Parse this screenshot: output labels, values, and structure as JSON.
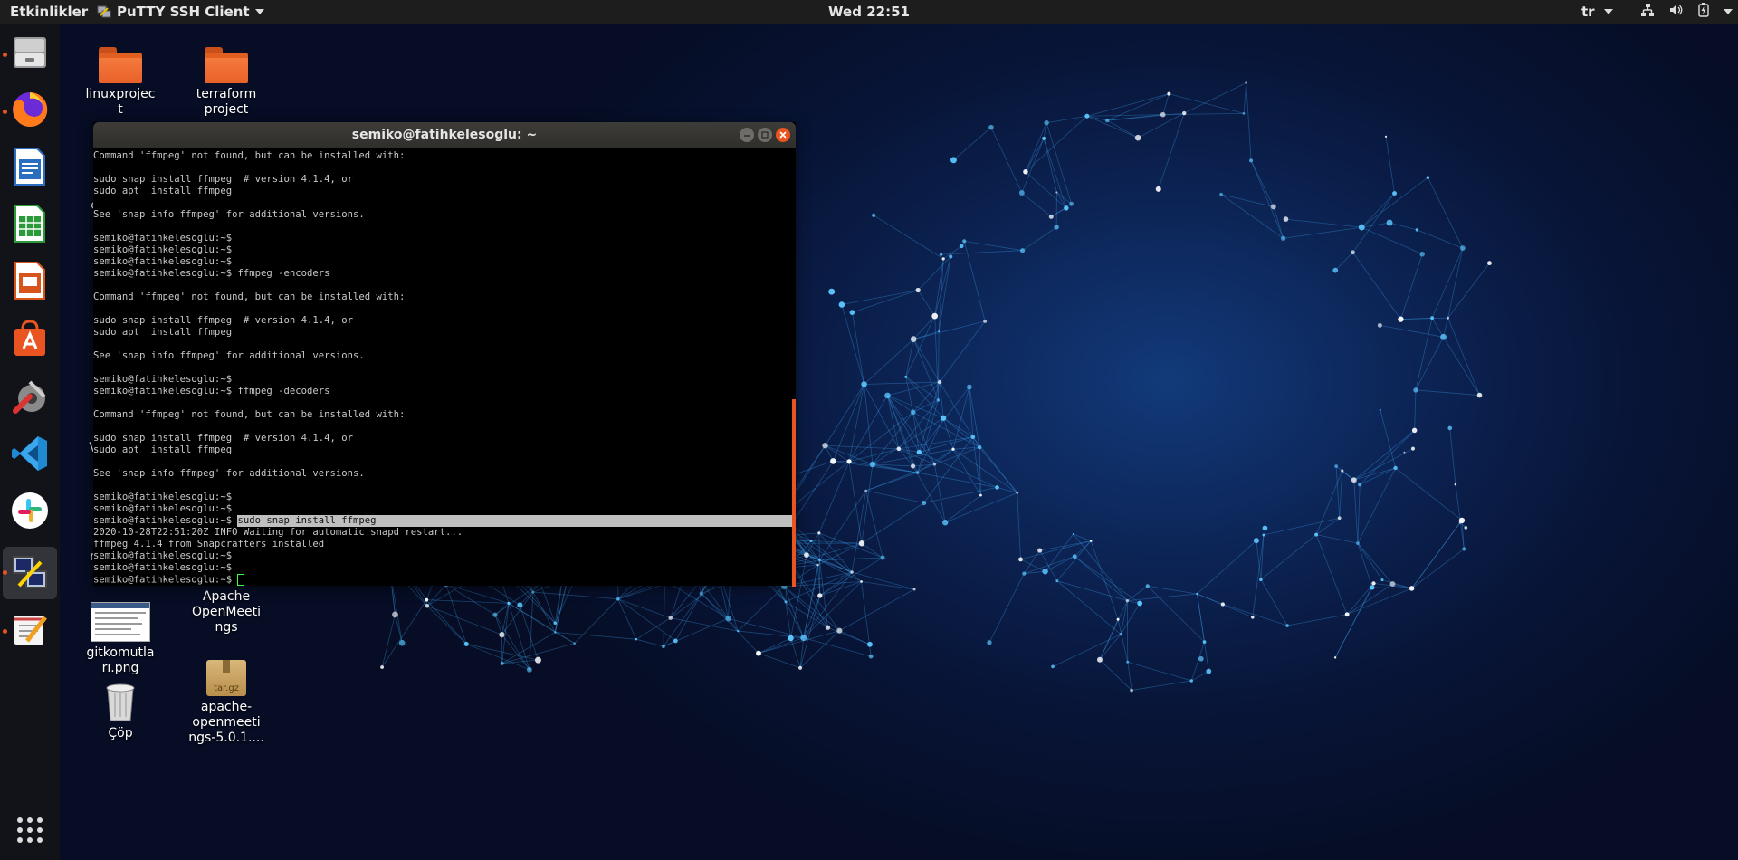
{
  "topbar": {
    "activities": "Etkinlikler",
    "app_name": "PuTTY SSH Client",
    "clock": "Wed 22:51",
    "language": "tr"
  },
  "desktop": {
    "icons": [
      {
        "label": "linuxprojec\nt",
        "type": "folder"
      },
      {
        "label": "terraform\nproject",
        "type": "folder"
      },
      {
        "label": "Apache\nOpenMeeti\nngs",
        "type": "folder"
      },
      {
        "label": "gitkomutla\nrı.png",
        "type": "image"
      },
      {
        "label": "Çöp",
        "type": "trash"
      },
      {
        "label": "apache-\nopenmeeti\nngs-5.0.1....",
        "type": "archive"
      }
    ],
    "archive_badge": "tar.gz",
    "partial_labels": [
      "c",
      "V",
      "n"
    ]
  },
  "dock": {
    "items": [
      "files-icon",
      "firefox-icon",
      "writer-icon",
      "calc-icon",
      "impress-icon",
      "software-icon",
      "settings-icon",
      "vscode-icon",
      "slack-icon",
      "putty-icon",
      "text-editor-icon"
    ],
    "apps_grid": "show-applications-icon"
  },
  "terminal": {
    "title": "semiko@fatihkelesoglu: ~",
    "lines": [
      "Command 'ffmpeg' not found, but can be installed with:",
      "",
      "sudo snap install ffmpeg  # version 4.1.4, or",
      "sudo apt  install ffmpeg",
      "",
      "See 'snap info ffmpeg' for additional versions.",
      "",
      "semiko@fatihkelesoglu:~$",
      "semiko@fatihkelesoglu:~$",
      "semiko@fatihkelesoglu:~$",
      "semiko@fatihkelesoglu:~$ ffmpeg -encoders",
      "",
      "Command 'ffmpeg' not found, but can be installed with:",
      "",
      "sudo snap install ffmpeg  # version 4.1.4, or",
      "sudo apt  install ffmpeg",
      "",
      "See 'snap info ffmpeg' for additional versions.",
      "",
      "semiko@fatihkelesoglu:~$",
      "semiko@fatihkelesoglu:~$ ffmpeg -decoders",
      "",
      "Command 'ffmpeg' not found, but can be installed with:",
      "",
      "sudo snap install ffmpeg  # version 4.1.4, or",
      "sudo apt  install ffmpeg",
      "",
      "See 'snap info ffmpeg' for additional versions.",
      "",
      "semiko@fatihkelesoglu:~$",
      "semiko@fatihkelesoglu:~$",
      "semiko@fatihkelesoglu:~$ "
    ],
    "highlighted_command": "sudo snap install ffmpeg",
    "after_lines": [
      "2020-10-28T22:51:20Z INFO Waiting for automatic snapd restart...",
      "ffmpeg 4.1.4 from Snapcrafters installed",
      "semiko@fatihkelesoglu:~$",
      "semiko@fatihkelesoglu:~$"
    ],
    "final_prompt": "semiko@fatihkelesoglu:~$ "
  },
  "colors": {
    "accent": "#e95420",
    "topbar": "#1d1d1d",
    "terminal_bg": "#000000",
    "terminal_fg": "#c8c8c8"
  }
}
